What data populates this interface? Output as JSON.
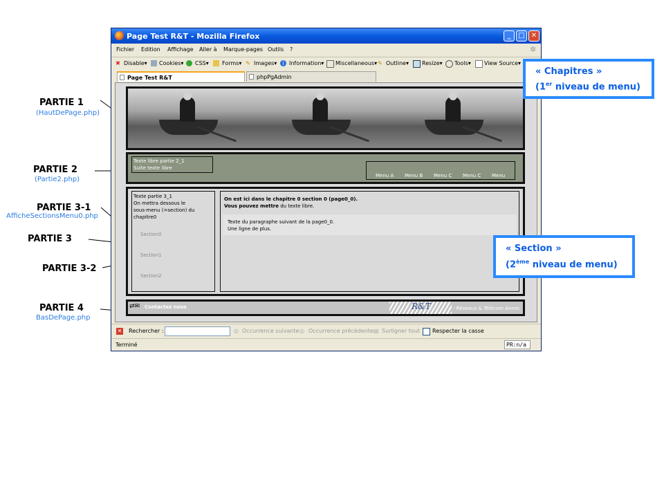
{
  "window": {
    "title": "Page Test R&T - Mozilla Firefox",
    "menu": [
      "Fichier",
      "Edition",
      "Affichage",
      "Aller à",
      "Marque-pages",
      "Outils",
      "?"
    ],
    "toolbar": [
      "Disable▾",
      "Cookies▾",
      "CSS▾",
      "Forms▾",
      "Images▾",
      "Information▾",
      "Miscellaneous▾",
      "Outline▾",
      "Resize▾",
      "Tools▾",
      "View Source▾"
    ],
    "tabs": [
      "Page Test R&T",
      "phpPgAdmin"
    ],
    "findbar": {
      "label": "Rechercher :",
      "next": "Occurrence suivante",
      "prev": "Occurrence précédente",
      "highlight": "Surligner tout",
      "matchcase": "Respecter la casse"
    },
    "status": "Terminé",
    "status_right": "PR:n/a"
  },
  "page": {
    "p2_text_line1": "Texte libre partie 2_1",
    "p2_text_line2": "Suite texte libre",
    "chapters": [
      "Menu A",
      "Menu B",
      "Menu C",
      "Menu C",
      "Menu"
    ],
    "p3_left_text": [
      "Texte partie 3_1",
      "On mettra dessous le",
      "sous-menu (=section) du",
      "chapitre0"
    ],
    "sections": [
      "Section0",
      "Section1",
      "Section2"
    ],
    "p3_right_bold1": "On est ici dans le chapitre 0 section 0 (page0_0).",
    "p3_right_bold2": "Vous pouvez mettre",
    "p3_right_rest2": " du texte libre.",
    "p3_right_para1": "Texte du paragraphe suivant de la page0_0.",
    "p3_right_para2": "Une ligne de plus.",
    "footer_contact": "Contactez nous",
    "footer_logo": "R&T",
    "footer_right": "- Réseaux & Télécom Annec"
  },
  "annotations": {
    "p1": "PARTIE 1",
    "p1_file": "(HautDePage.php)",
    "p2": "PARTIE 2",
    "p2_file": "(Partie2.php)",
    "p31": "PARTIE 3-1",
    "p31_file": "AfficheSectionsMenu0.php",
    "p3": "PARTIE 3",
    "p32": "PARTIE 3-2",
    "p4": "PARTIE 4",
    "p4_file": "BasDePage.php",
    "chapitres_line1": "« Chapitres »",
    "chapitres_line2_a": "(1",
    "chapitres_line2_sup": "er",
    "chapitres_line2_b": " niveau de menu)",
    "section_line1": "« Section »",
    "section_line2_a": "(2",
    "section_line2_sup": "ème",
    "section_line2_b": " niveau de menu)"
  },
  "colors": {
    "arrow": "#2a8aff",
    "callout_text": "#0b5fe3",
    "file_text": "#2a7be0"
  }
}
